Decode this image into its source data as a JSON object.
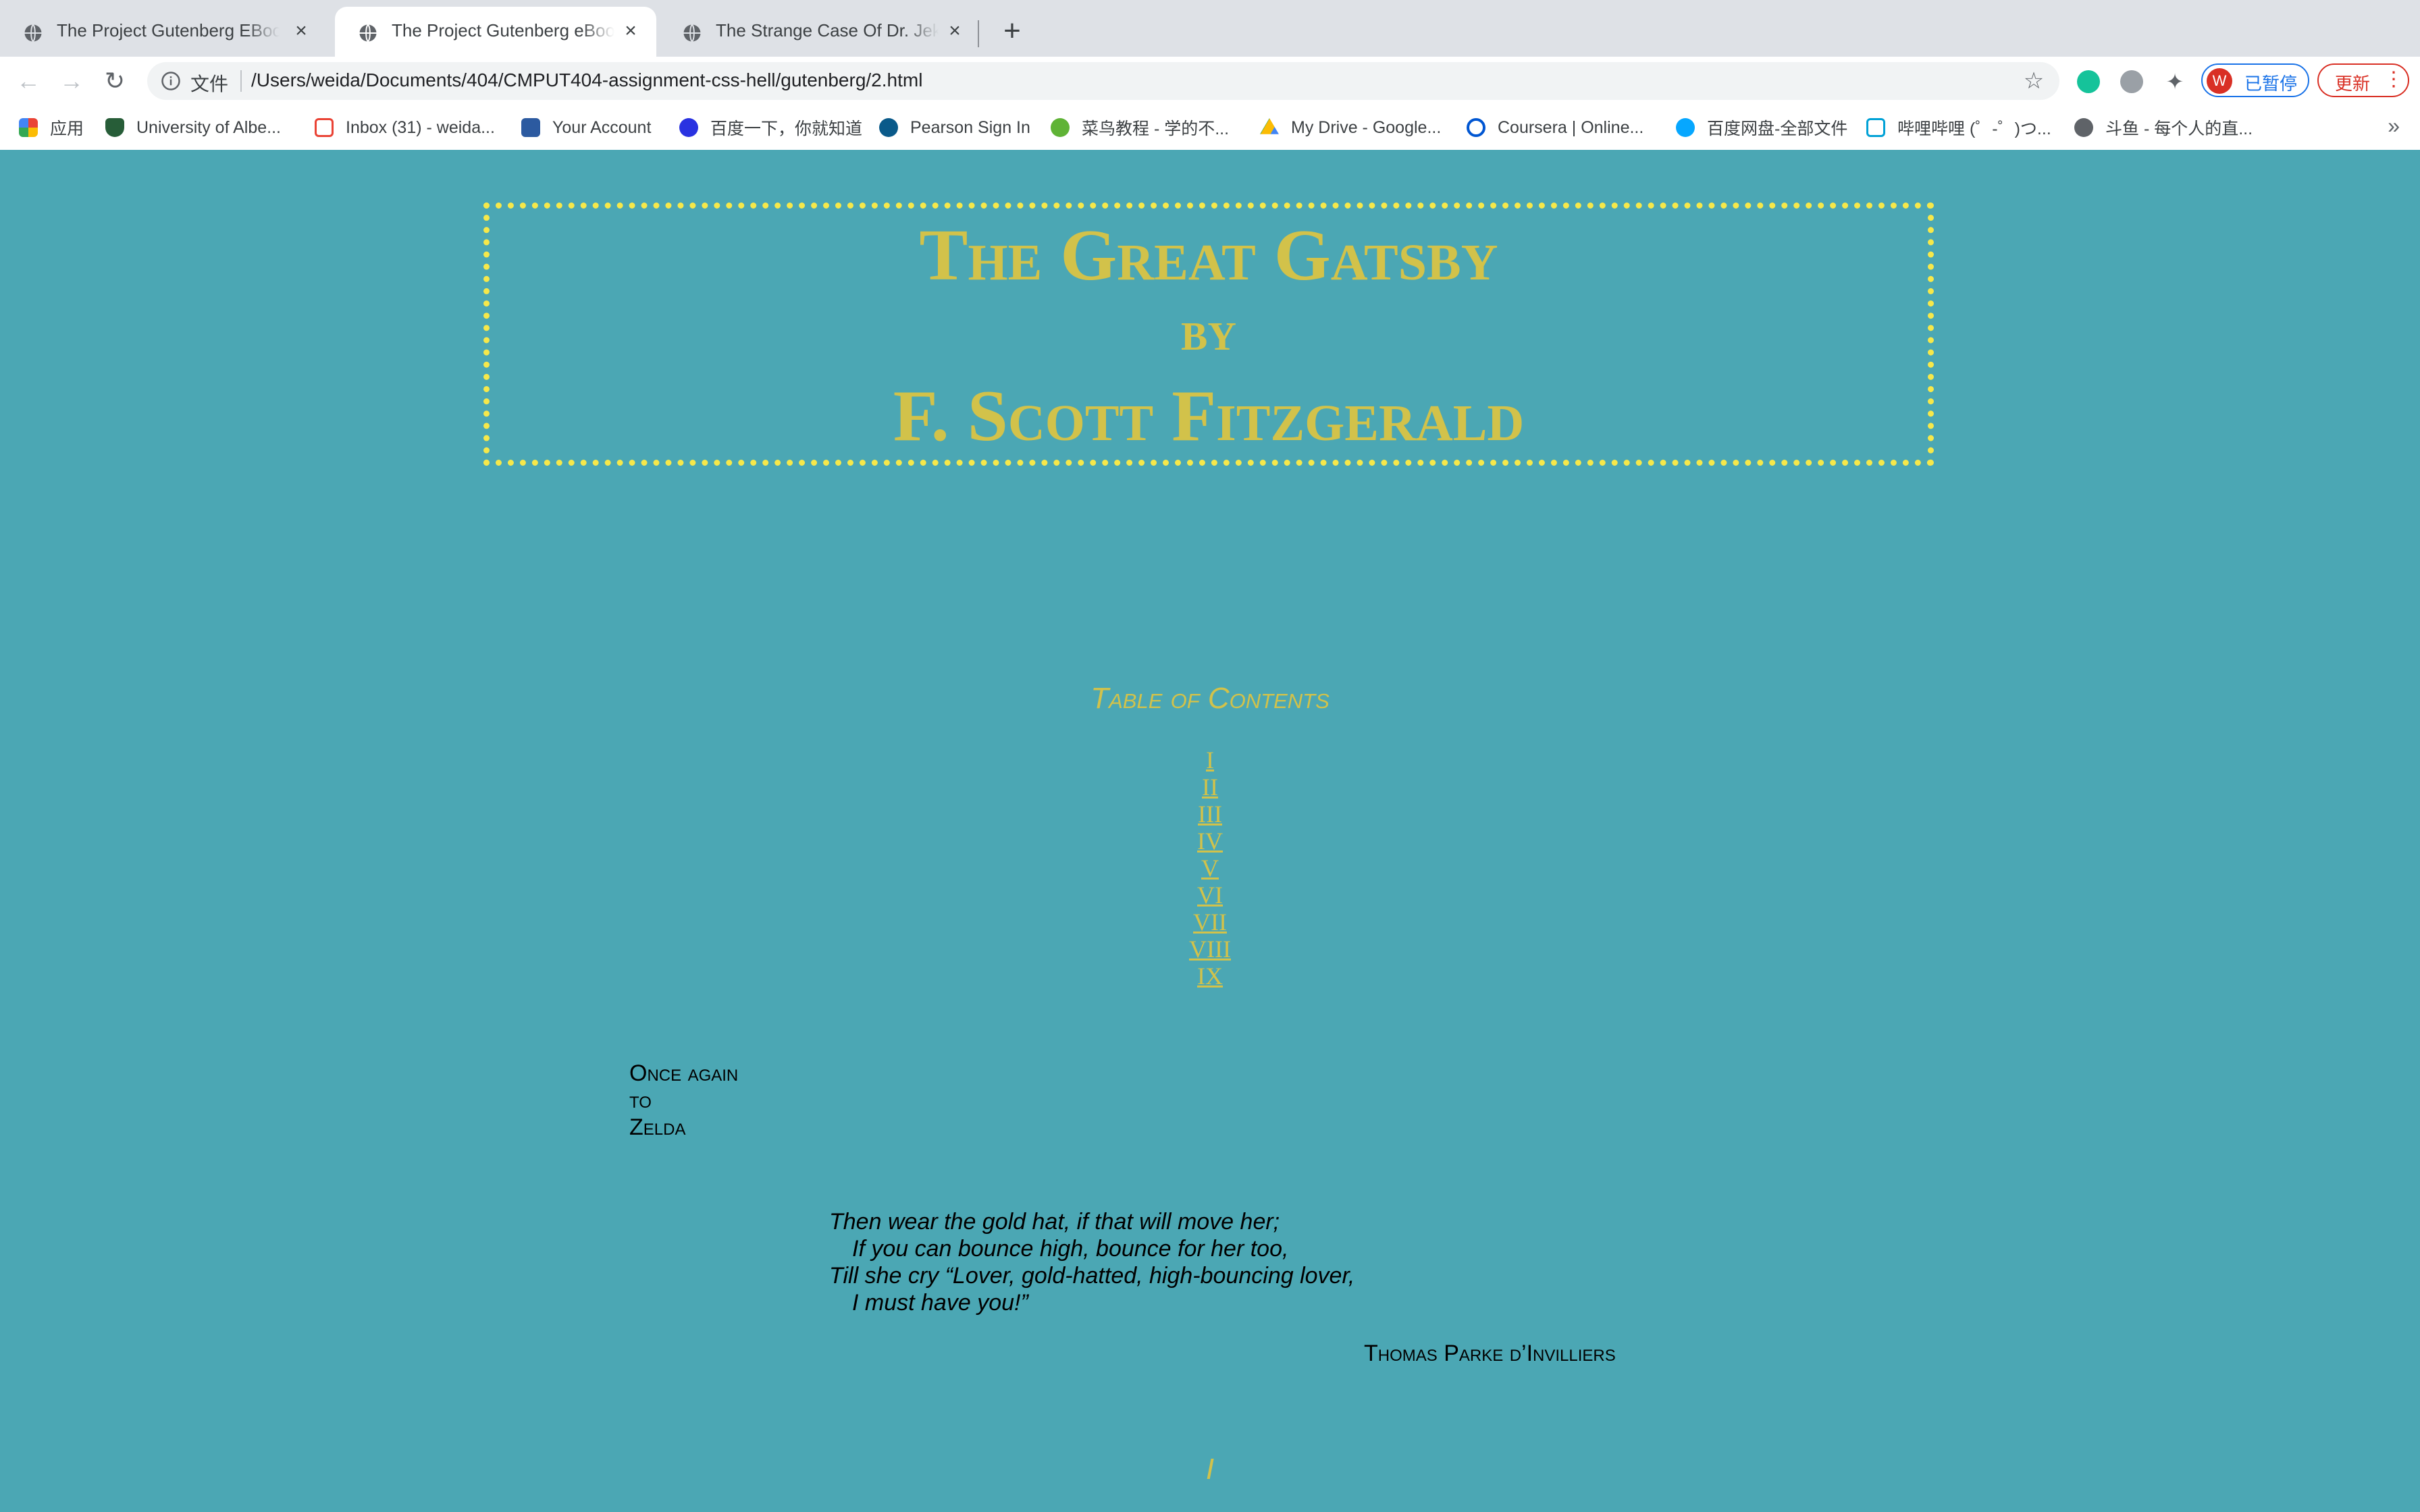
{
  "browser": {
    "tabs": [
      {
        "title": "The Project Gutenberg EBook of The Great Gatsby",
        "active": false
      },
      {
        "title": "The Project Gutenberg eBook of The Great Gatsby",
        "active": true
      },
      {
        "title": "The Strange Case Of Dr. Jekyll And Mr. Hyde",
        "active": false
      }
    ],
    "scheme_label": "文件",
    "url": "/Users/weida/Documents/404/CMPUT404-assignment-css-hell/gutenberg/2.html",
    "profile_initial": "W",
    "profile_label": "已暂停",
    "update_label": "更新",
    "bookmarks": [
      {
        "label": "应用",
        "icon": "apps-grid-icon",
        "color": "#4285f4"
      },
      {
        "label": "University of Albe...",
        "icon": "university-shield-icon",
        "color": "#275d38"
      },
      {
        "label": "Inbox (31) - weida...",
        "icon": "gmail-icon",
        "color": "#ea4335"
      },
      {
        "label": "Your Account",
        "icon": "account-icon",
        "color": "#2c5aa0"
      },
      {
        "label": "百度一下，你就知道",
        "icon": "baidu-paw-icon",
        "color": "#2932e1"
      },
      {
        "label": "Pearson Sign In",
        "icon": "pearson-icon",
        "color": "#0a5a8a"
      },
      {
        "label": "菜鸟教程 - 学的不...",
        "icon": "runoob-icon",
        "color": "#5fb336"
      },
      {
        "label": "My Drive - Google...",
        "icon": "google-drive-icon",
        "color": "#fbbc04"
      },
      {
        "label": "Coursera | Online...",
        "icon": "coursera-icon",
        "color": "#0056d2"
      },
      {
        "label": "百度网盘-全部文件",
        "icon": "baidu-netdisk-icon",
        "color": "#06a7ff"
      },
      {
        "label": "哔哩哔哩 (゜-゜)つ...",
        "icon": "bilibili-icon",
        "color": "#00a1d6"
      },
      {
        "label": "斗鱼 - 每个人的直...",
        "icon": "globe-icon",
        "color": "#5f6368"
      }
    ]
  },
  "page": {
    "title_line1": "The Great Gatsby",
    "title_line2": "by",
    "title_line3": "F. Scott Fitzgerald",
    "toc_heading": "Table of Contents",
    "toc": [
      "I",
      "II",
      "III",
      "IV",
      "V",
      "VI",
      "VII",
      "VIII",
      "IX"
    ],
    "dedication": [
      "Once again",
      "to",
      "Zelda"
    ],
    "epigraph": [
      "Then wear the gold hat, if that will move her;",
      "If you can bounce high, bounce for her too,",
      "Till she cry “Lover, gold-hatted, high-bouncing lover,",
      "I must have you!”"
    ],
    "attribution": "Thomas Parke d’Invilliers",
    "chapter_heading": "I"
  },
  "colors": {
    "page_background": "#4ba7b4",
    "title_text": "#d2c24a",
    "title_border": "#f6e84a"
  }
}
